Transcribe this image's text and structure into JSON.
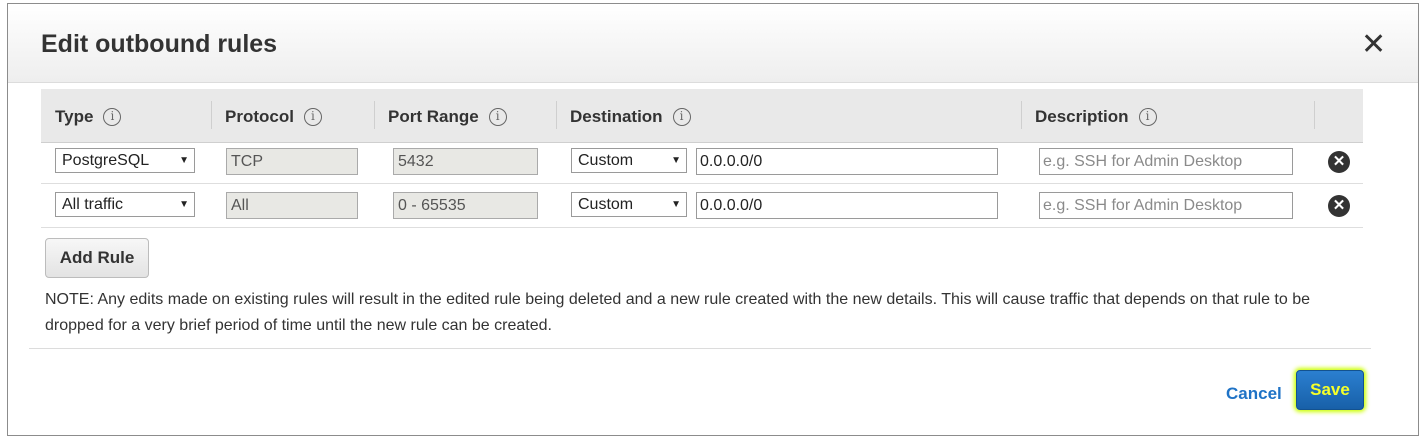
{
  "dialog": {
    "title": "Edit outbound rules",
    "close_icon": "close-icon"
  },
  "table": {
    "columns": [
      {
        "label": "Type",
        "info_icon": "info-icon"
      },
      {
        "label": "Protocol",
        "info_icon": "info-icon"
      },
      {
        "label": "Port Range",
        "info_icon": "info-icon"
      },
      {
        "label": "Destination",
        "info_icon": "info-icon"
      },
      {
        "label": "Description",
        "info_icon": "info-icon"
      }
    ],
    "rows": [
      {
        "type": "PostgreSQL",
        "protocol": "TCP",
        "port_range": "5432",
        "destination_mode": "Custom",
        "destination_value": "0.0.0.0/0",
        "description_placeholder": "e.g. SSH for Admin Desktop"
      },
      {
        "type": "All traffic",
        "protocol": "All",
        "port_range": "0 - 65535",
        "destination_mode": "Custom",
        "destination_value": "0.0.0.0/0",
        "description_placeholder": "e.g. SSH for Admin Desktop"
      }
    ]
  },
  "add_rule_label": "Add Rule",
  "note": "NOTE: Any edits made on existing rules will result in the edited rule being deleted and a new rule created with the new details. This will cause traffic that depends on that rule to be dropped for a very brief period of time until the new rule can be created.",
  "footer": {
    "cancel_label": "Cancel",
    "save_label": "Save"
  },
  "colors": {
    "link": "#1f73c6",
    "primary_button": "#1a6ab8",
    "save_highlight": "#ccff00"
  }
}
